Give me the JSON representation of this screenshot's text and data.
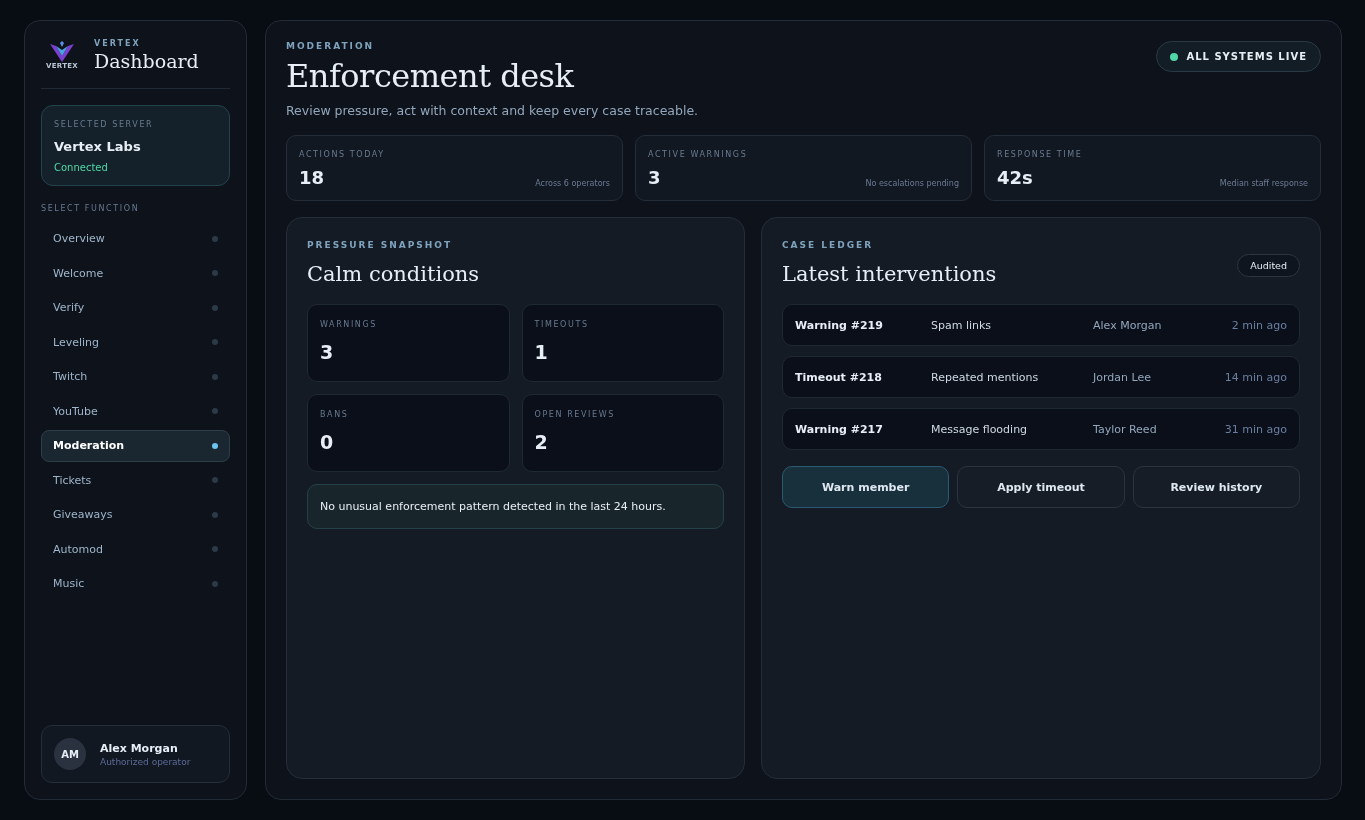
{
  "sidebar": {
    "brand": {
      "logo_text": "VERTEX",
      "eyebrow": "VERTEX",
      "title": "Dashboard"
    },
    "server": {
      "label": "SELECTED SERVER",
      "name": "Vertex Labs",
      "status": "Connected"
    },
    "nav_label": "SELECT FUNCTION",
    "items": [
      {
        "label": "Overview",
        "selected": false
      },
      {
        "label": "Welcome",
        "selected": false
      },
      {
        "label": "Verify",
        "selected": false
      },
      {
        "label": "Leveling",
        "selected": false
      },
      {
        "label": "Twitch",
        "selected": false
      },
      {
        "label": "YouTube",
        "selected": false
      },
      {
        "label": "Moderation",
        "selected": true
      },
      {
        "label": "Tickets",
        "selected": false
      },
      {
        "label": "Giveaways",
        "selected": false
      },
      {
        "label": "Automod",
        "selected": false
      },
      {
        "label": "Music",
        "selected": false
      }
    ],
    "user": {
      "initials": "AM",
      "name": "Alex Morgan",
      "role": "Authorized operator"
    }
  },
  "header": {
    "eyebrow": "MODERATION",
    "title": "Enforcement desk",
    "subtitle": "Review pressure, act with context and keep every case traceable.",
    "status": "ALL SYSTEMS LIVE"
  },
  "stats": [
    {
      "label": "ACTIONS TODAY",
      "value": "18",
      "note": "Across 6 operators"
    },
    {
      "label": "ACTIVE WARNINGS",
      "value": "3",
      "note": "No escalations pending"
    },
    {
      "label": "RESPONSE TIME",
      "value": "42s",
      "note": "Median staff response"
    }
  ],
  "snapshot": {
    "eyebrow": "PRESSURE SNAPSHOT",
    "title": "Calm conditions",
    "tiles": [
      {
        "label": "WARNINGS",
        "value": "3"
      },
      {
        "label": "TIMEOUTS",
        "value": "1"
      },
      {
        "label": "BANS",
        "value": "0"
      },
      {
        "label": "OPEN REVIEWS",
        "value": "2"
      }
    ],
    "notice": "No unusual enforcement pattern detected in the last 24 hours."
  },
  "ledger": {
    "eyebrow": "CASE LEDGER",
    "title": "Latest interventions",
    "badge": "Audited",
    "rows": [
      {
        "case": "Warning #219",
        "reason": "Spam links",
        "moderator": "Alex Morgan",
        "time": "2 min ago"
      },
      {
        "case": "Timeout #218",
        "reason": "Repeated mentions",
        "moderator": "Jordan Lee",
        "time": "14 min ago"
      },
      {
        "case": "Warning #217",
        "reason": "Message flooding",
        "moderator": "Taylor Reed",
        "time": "31 min ago"
      }
    ],
    "actions": [
      {
        "label": "Warn member",
        "kind": "primary"
      },
      {
        "label": "Apply timeout",
        "kind": "secondary"
      },
      {
        "label": "Review history",
        "kind": "secondary"
      }
    ]
  }
}
